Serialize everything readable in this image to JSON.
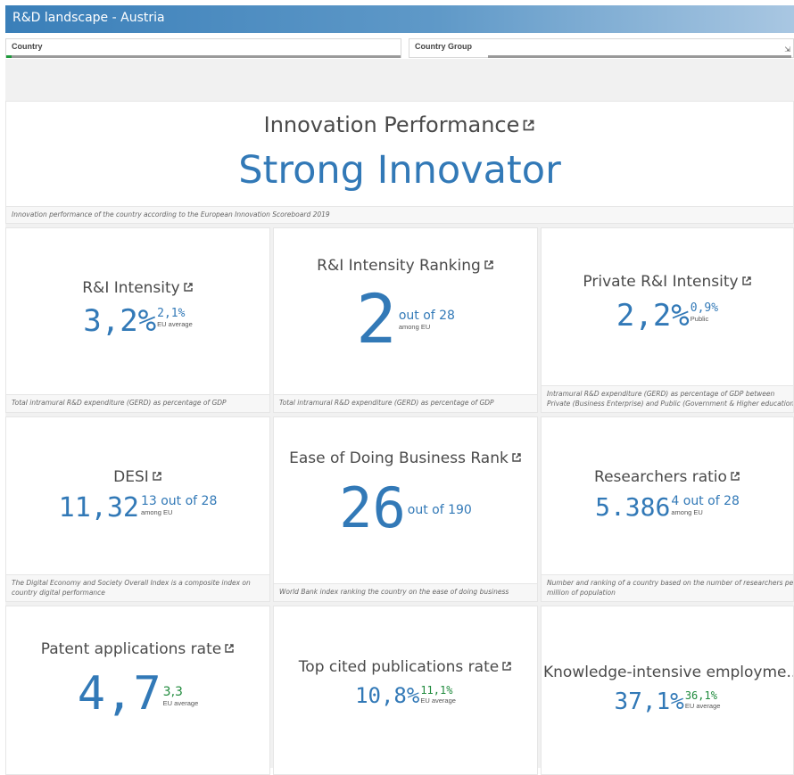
{
  "app": {
    "title": "R&D landscape - Austria"
  },
  "filters": {
    "country": "Country",
    "country_group": "Country Group"
  },
  "innovation": {
    "title": "Innovation Performance",
    "value": "Strong Innovator",
    "footer": "Innovation performance of the country according to the European Innovation Scoreboard 2019"
  },
  "ri_intensity": {
    "title": "R&I Intensity",
    "value": "3,2%",
    "compare": "2,1%",
    "compare_label": "EU average",
    "footer": "Total intramural R&D expenditure (GERD) as percentage of GDP"
  },
  "ri_ranking": {
    "title": "R&I Intensity Ranking",
    "value": "2",
    "compare": "out of 28",
    "compare_label": "among EU",
    "footer": "Total intramural R&D expenditure (GERD) as percentage of GDP"
  },
  "private_ri": {
    "title": "Private R&I Intensity",
    "value": "2,2%",
    "compare": "0,9%",
    "compare_label": "Public",
    "footer_line1": "Intramural R&D expenditure (GERD) as percentage of GDP between",
    "footer_line2": "Private (Business Enterprise) and Public (Government & Higher education)"
  },
  "desi": {
    "title": "DESI",
    "value": "11,32",
    "compare": "13 out of 28",
    "compare_label": "among EU",
    "footer_line1": "The Digital Economy and Society Overall Index is a composite index on",
    "footer_line2": "country digital performance"
  },
  "ease_business": {
    "title": "Ease of Doing Business Rank",
    "value": "26",
    "compare": "out of 190",
    "footer": "World Bank index ranking the country on the ease of doing business"
  },
  "researchers": {
    "title": "Researchers ratio",
    "value": "5.386",
    "compare": "4 out of 28",
    "compare_label": "among EU",
    "footer_line1": "Number and ranking of a country based on the number of researchers per",
    "footer_line2": "million of population"
  },
  "patents": {
    "title": "Patent applications rate",
    "value": "4,7",
    "compare": "3,3",
    "compare_label": "EU average"
  },
  "top_cited": {
    "title": "Top cited publications rate",
    "value": "10,8%",
    "compare": "11,1%",
    "compare_label": "EU average"
  },
  "knowledge": {
    "title": "Knowledge-intensive employme...",
    "value": "37,1%",
    "compare": "36,1%",
    "compare_label": "EU average"
  },
  "colors": {
    "accent": "#3279b7",
    "positive": "#1f8a3c",
    "titlebar": "#3a7fb9"
  },
  "icons": {
    "external_link": "external-link-icon"
  }
}
